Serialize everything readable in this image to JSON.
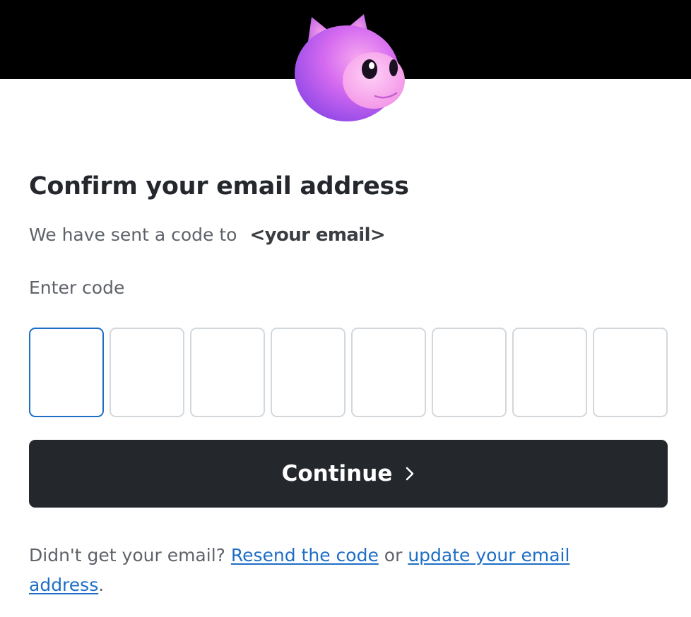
{
  "header": {
    "band_color": "#000000",
    "mascot_icon": "cat-mascot-icon"
  },
  "main": {
    "title": "Confirm your email address",
    "sent_prefix": "We have sent a code to",
    "email_placeholder": "<your email>",
    "code_label": "Enter code",
    "code_digits": [
      "",
      "",
      "",
      "",
      "",
      "",
      "",
      ""
    ],
    "continue_label": "Continue",
    "continue_icon": "chevron-right-icon"
  },
  "footer": {
    "prefix": "Didn't get your email?",
    "resend_link": "Resend the code",
    "connector": "or",
    "update_link": "update your email address",
    "suffix": "."
  },
  "colors": {
    "button_bg": "#24272c",
    "link": "#1e6ec6",
    "focus_border": "#1e6ec6",
    "box_border": "#d3d8dc",
    "muted_text": "#5f6369"
  }
}
